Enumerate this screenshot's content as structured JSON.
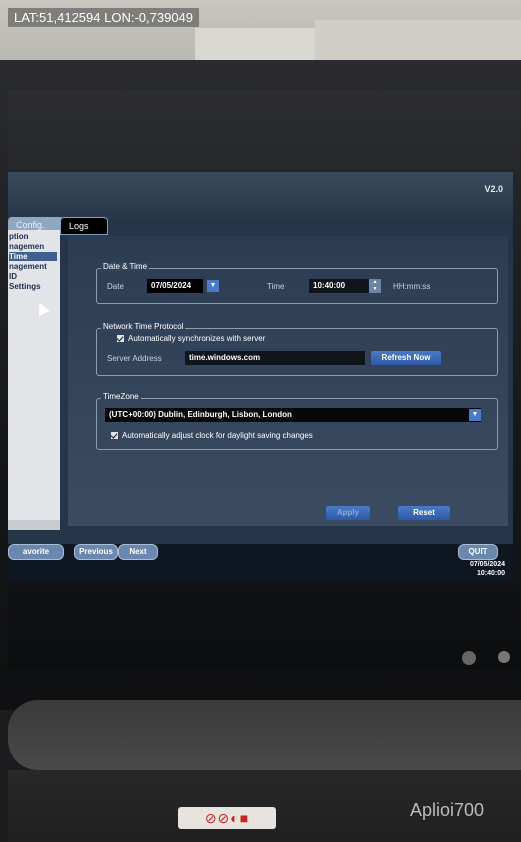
{
  "overlay": {
    "gps": "LAT:51,412594 LON:-0,739049"
  },
  "app": {
    "version": "V2.0",
    "tabs": [
      {
        "label": "Config."
      },
      {
        "label": "Logs"
      }
    ],
    "sidebar": {
      "items": [
        "ption",
        "nagemen",
        "Time",
        "nagement",
        "ID",
        "Settings"
      ],
      "selected": "Time"
    },
    "date_time": {
      "title": "Date & Time",
      "date_label": "Date",
      "date_value": "07/05/2024",
      "time_label": "Time",
      "time_value": "10:40:00",
      "time_format": "HH:mm:ss"
    },
    "ntp": {
      "title": "Network Time Protocol",
      "auto_sync_label": "Automatically synchronizes with server",
      "server_label": "Server Address",
      "server_value": "time.windows.com",
      "refresh_label": "Refresh Now"
    },
    "timezone": {
      "title": "TimeZone",
      "value": "(UTC+00:00) Dublin, Edinburgh, Lisbon, London",
      "dst_label": "Automatically adjust clock for daylight saving changes"
    },
    "actions": {
      "apply": "Apply",
      "reset": "Reset"
    },
    "footer": {
      "favorite": "avorite",
      "previous": "Previous",
      "next": "Next",
      "quit": "QUIT",
      "date": "07/05/2024",
      "time": "10:40:00"
    }
  },
  "device": {
    "brand": "Aplio",
    "model": "i700"
  }
}
